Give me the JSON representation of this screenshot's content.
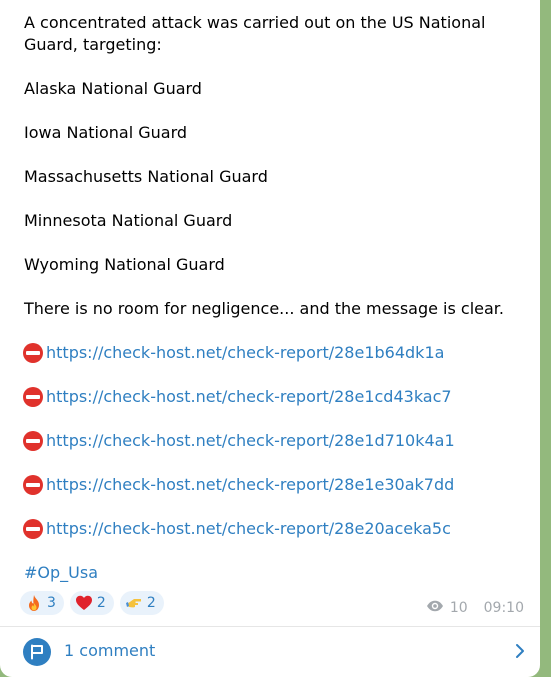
{
  "message": {
    "paragraphs": [
      "A concentrated attack was carried out on the US National Guard, targeting:",
      "Alaska National Guard",
      "Iowa National Guard",
      "Massachusetts National Guard",
      "Minnesota National Guard",
      "Wyoming National Guard",
      "There is no room for negligence... and the message is clear."
    ],
    "links": [
      {
        "icon": "stop-sign-icon",
        "text": "https://check-host.net/check-report/28e1b64dk1a"
      },
      {
        "icon": "stop-sign-icon",
        "text": "https://check-host.net/check-report/28e1cd43kac7"
      },
      {
        "icon": "stop-sign-icon",
        "text": "https://check-host.net/check-report/28e1d710k4a1"
      },
      {
        "icon": "stop-sign-icon",
        "text": "https://check-host.net/check-report/28e1e30ak7dd"
      },
      {
        "icon": "stop-sign-icon",
        "text": "https://check-host.net/check-report/28e20aceka5c"
      }
    ],
    "hashtag": "#Op_Usa"
  },
  "reactions": [
    {
      "emoji": "fire-icon",
      "count": "3"
    },
    {
      "emoji": "heart-icon",
      "count": "2"
    },
    {
      "emoji": "pointing-hand-icon",
      "count": "2"
    }
  ],
  "meta": {
    "views": "10",
    "time": "09:10"
  },
  "comments": {
    "label": "1 comment"
  },
  "colors": {
    "link": "#2f7fc1",
    "reaction_bg": "#e9f2fb",
    "meta": "#a3a8ad",
    "background": "#9fbf86"
  }
}
